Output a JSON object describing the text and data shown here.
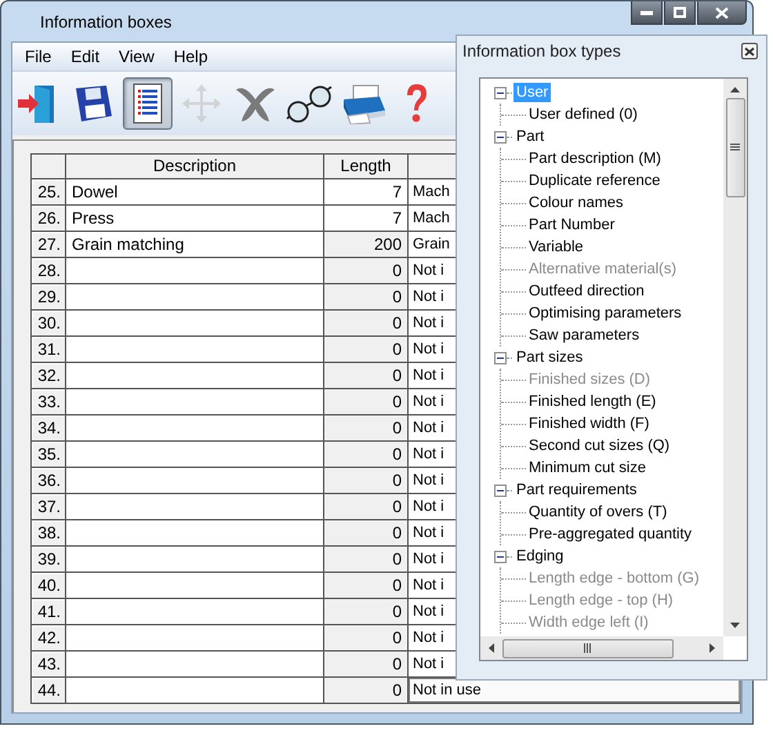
{
  "window": {
    "title": "Information boxes"
  },
  "menu": [
    "File",
    "Edit",
    "View",
    "Help"
  ],
  "toolbar": [
    {
      "kind": "exit",
      "selected": false,
      "disabled": false
    },
    {
      "kind": "save",
      "selected": false,
      "disabled": false
    },
    {
      "kind": "list",
      "selected": true,
      "disabled": false
    },
    {
      "kind": "move",
      "selected": false,
      "disabled": true
    },
    {
      "kind": "delete",
      "selected": false,
      "disabled": false
    },
    {
      "kind": "glasses",
      "selected": false,
      "disabled": false
    },
    {
      "kind": "printer",
      "selected": false,
      "disabled": false
    },
    {
      "kind": "help",
      "selected": false,
      "disabled": false
    }
  ],
  "table": {
    "columns": [
      "Description",
      "Length"
    ],
    "rows": [
      {
        "number": "25.",
        "description": "Dowel",
        "length": "7",
        "column_3": "Mach",
        "length_readonly": false,
        "selected": false
      },
      {
        "number": "26.",
        "description": "Press",
        "length": "7",
        "column_3": "Mach",
        "length_readonly": false,
        "selected": false
      },
      {
        "number": "27.",
        "description": "Grain matching",
        "length": "200",
        "column_3": "Grain",
        "length_readonly": true,
        "selected": false
      },
      {
        "number": "28.",
        "length": "0",
        "column_3": "Not i",
        "length_readonly": true,
        "selected": false
      },
      {
        "number": "29.",
        "length": "0",
        "column_3": "Not i",
        "length_readonly": true,
        "selected": false
      },
      {
        "number": "30.",
        "length": "0",
        "column_3": "Not i",
        "length_readonly": true,
        "selected": false
      },
      {
        "number": "31.",
        "length": "0",
        "column_3": "Not i",
        "length_readonly": true,
        "selected": false
      },
      {
        "number": "32.",
        "length": "0",
        "column_3": "Not i",
        "length_readonly": true,
        "selected": false
      },
      {
        "number": "33.",
        "length": "0",
        "column_3": "Not i",
        "length_readonly": true,
        "selected": false
      },
      {
        "number": "34.",
        "length": "0",
        "column_3": "Not i",
        "length_readonly": true,
        "selected": false
      },
      {
        "number": "35.",
        "length": "0",
        "column_3": "Not i",
        "length_readonly": true,
        "selected": false
      },
      {
        "number": "36.",
        "length": "0",
        "column_3": "Not i",
        "length_readonly": true,
        "selected": false
      },
      {
        "number": "37.",
        "length": "0",
        "column_3": "Not i",
        "length_readonly": true,
        "selected": false
      },
      {
        "number": "38.",
        "length": "0",
        "column_3": "Not i",
        "length_readonly": true,
        "selected": false
      },
      {
        "number": "39.",
        "length": "0",
        "column_3": "Not i",
        "length_readonly": true,
        "selected": false
      },
      {
        "number": "40.",
        "length": "0",
        "column_3": "Not i",
        "length_readonly": true,
        "selected": false
      },
      {
        "number": "41.",
        "length": "0",
        "column_3": "Not i",
        "length_readonly": true,
        "selected": false
      },
      {
        "number": "42.",
        "length": "0",
        "column_3": "Not i",
        "length_readonly": true,
        "selected": false
      },
      {
        "number": "43.",
        "length": "0",
        "column_3": "Not i",
        "length_readonly": true,
        "selected": false
      },
      {
        "number": "44.",
        "length": "0",
        "column_3": "Not in use",
        "length_readonly": true,
        "selected": true
      }
    ]
  },
  "panel": {
    "title": "Information box types",
    "tree": [
      {
        "label": "User",
        "expanded": true,
        "selected": true,
        "disabled": false,
        "children": [
          {
            "label": "User defined (0)",
            "selected": false,
            "disabled": false
          }
        ]
      },
      {
        "label": "Part",
        "expanded": true,
        "selected": false,
        "disabled": false,
        "children": [
          {
            "label": "Part description (M)",
            "selected": false,
            "disabled": false
          },
          {
            "label": "Duplicate reference",
            "selected": false,
            "disabled": false
          },
          {
            "label": "Colour names",
            "selected": false,
            "disabled": false
          },
          {
            "label": "Part Number",
            "selected": false,
            "disabled": false
          },
          {
            "label": "Variable",
            "selected": false,
            "disabled": false
          },
          {
            "label": "Alternative material(s)",
            "selected": false,
            "disabled": true
          },
          {
            "label": "Outfeed direction",
            "selected": false,
            "disabled": false
          },
          {
            "label": "Optimising parameters",
            "selected": false,
            "disabled": false
          },
          {
            "label": "Saw parameters",
            "selected": false,
            "disabled": false
          }
        ]
      },
      {
        "label": "Part sizes",
        "expanded": true,
        "selected": false,
        "disabled": false,
        "children": [
          {
            "label": "Finished sizes (D)",
            "selected": false,
            "disabled": true
          },
          {
            "label": "Finished length (E)",
            "selected": false,
            "disabled": false
          },
          {
            "label": "Finished width (F)",
            "selected": false,
            "disabled": false
          },
          {
            "label": "Second cut sizes (Q)",
            "selected": false,
            "disabled": false
          },
          {
            "label": "Minimum cut size",
            "selected": false,
            "disabled": false
          }
        ]
      },
      {
        "label": "Part requirements",
        "expanded": true,
        "selected": false,
        "disabled": false,
        "children": [
          {
            "label": "Quantity of overs (T)",
            "selected": false,
            "disabled": false
          },
          {
            "label": "Pre-aggregated quantity",
            "selected": false,
            "disabled": false
          }
        ]
      },
      {
        "label": "Edging",
        "expanded": true,
        "selected": false,
        "disabled": false,
        "children": [
          {
            "label": "Length edge - bottom (G)",
            "selected": false,
            "disabled": true
          },
          {
            "label": "Length edge - top (H)",
            "selected": false,
            "disabled": true
          },
          {
            "label": "Width edge left (I)",
            "selected": false,
            "disabled": true
          }
        ]
      }
    ]
  }
}
